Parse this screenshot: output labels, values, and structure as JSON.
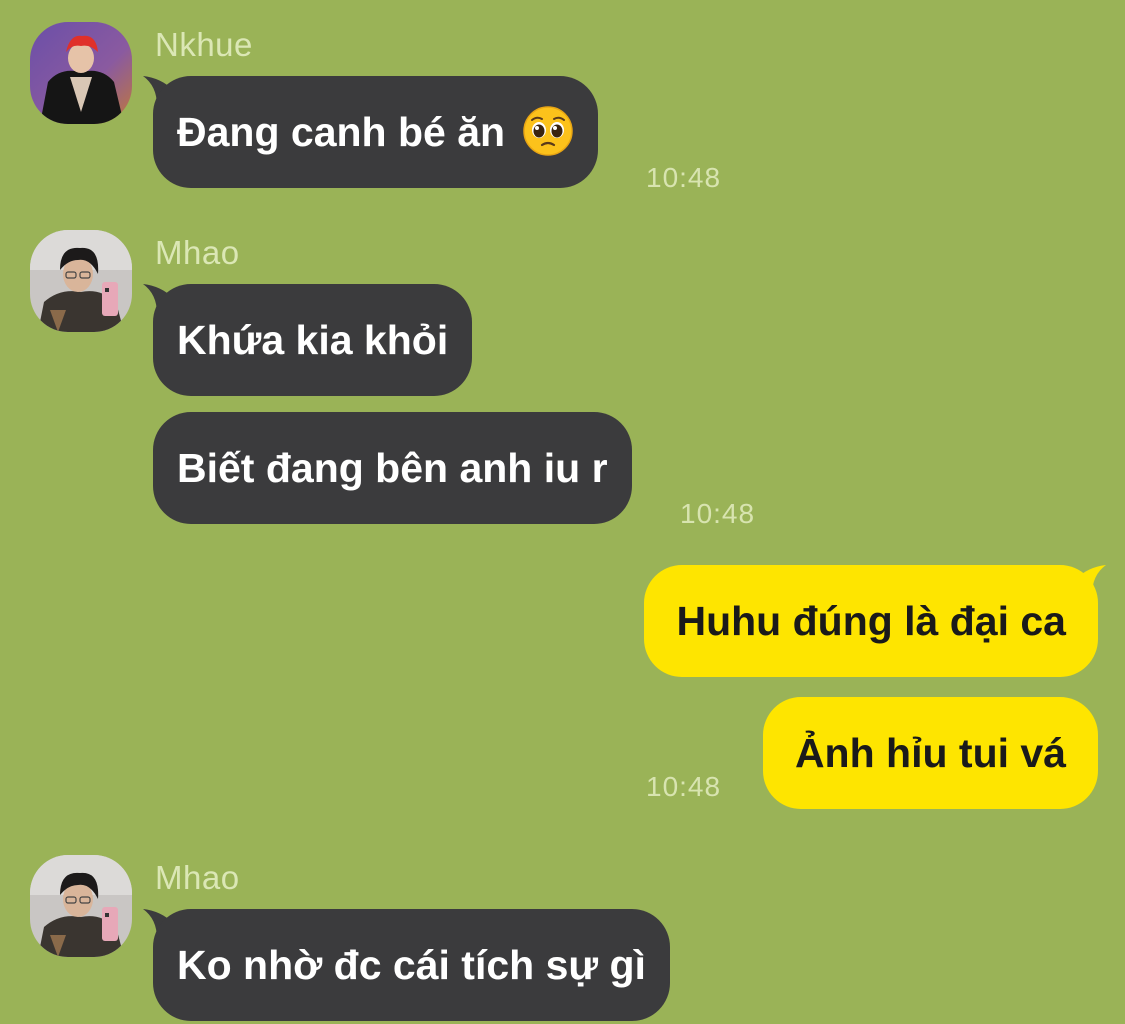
{
  "colors": {
    "background": "#9ab357",
    "incoming_bubble": "#3b3b3d",
    "outgoing_bubble": "#fee500",
    "sender_name": "#dbe7b5",
    "timestamp": "#d8e4b0"
  },
  "messages": [
    {
      "sender": "Nkhue",
      "avatar_icon": "profile-photo-red-hair",
      "bubbles": [
        {
          "text": "Đang canh bé ăn",
          "emoji": "pleading-face-emoji"
        }
      ],
      "time": "10:48"
    },
    {
      "sender": "Mhao",
      "avatar_icon": "profile-photo-mirror-selfie",
      "bubbles": [
        {
          "text": "Khứa kia khỏi"
        },
        {
          "text": "Biết đang bên anh iu r"
        }
      ],
      "time": "10:48"
    },
    {
      "sender": "",
      "outgoing": true,
      "bubbles": [
        {
          "text": "Huhu đúng là đại ca"
        },
        {
          "text": "Ảnh hỉu tui vá"
        }
      ],
      "time": "10:48"
    },
    {
      "sender": "Mhao",
      "avatar_icon": "profile-photo-mirror-selfie",
      "bubbles": [
        {
          "text": "Ko nhờ đc cái tích sự gì"
        }
      ],
      "time": ""
    }
  ]
}
